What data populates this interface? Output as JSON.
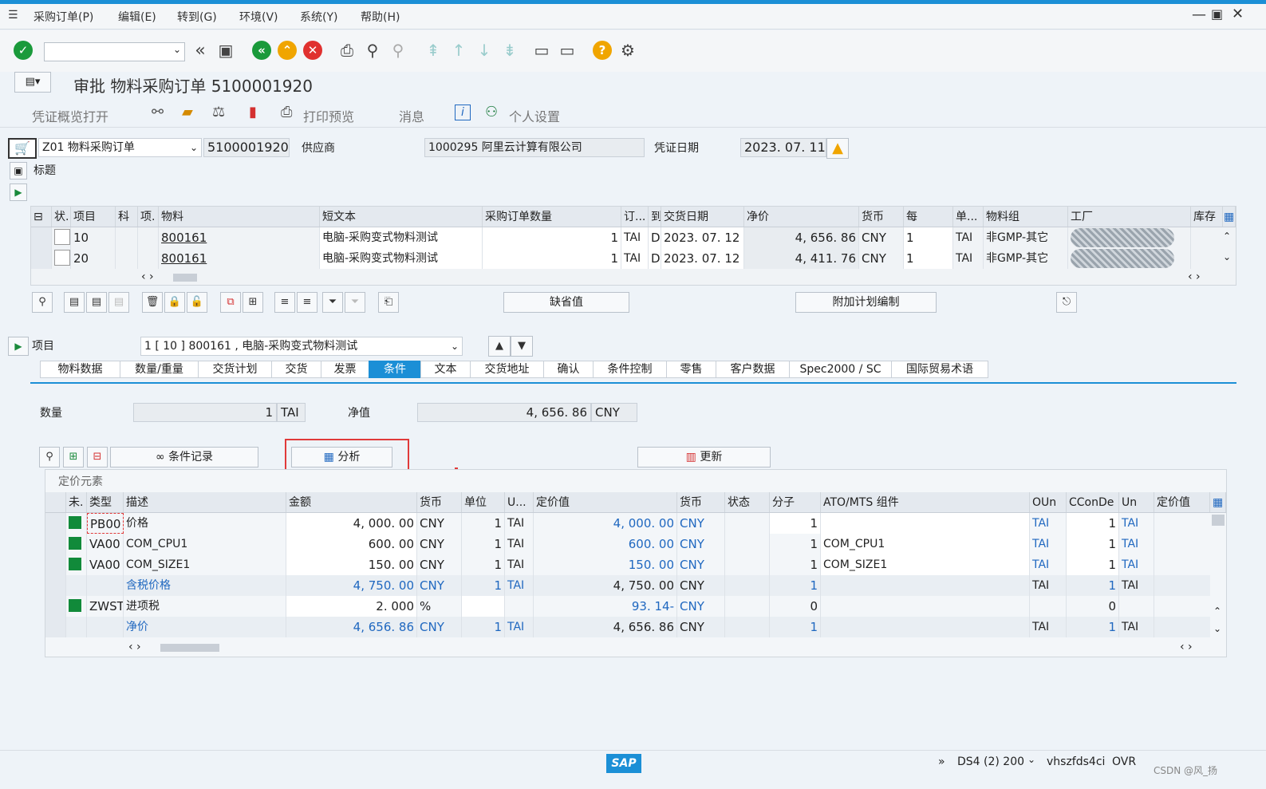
{
  "menu": [
    "采购订单(P)",
    "编辑(E)",
    "转到(G)",
    "环境(V)",
    "系统(Y)",
    "帮助(H)"
  ],
  "title": "审批 物料采购订单 5100001920",
  "app_toolbar": {
    "overview": "凭证概览打开",
    "print_preview": "打印预览",
    "messages": "消息",
    "personal": "个人设置"
  },
  "header": {
    "doc_type": "Z01 物料采购订单",
    "po_number": "5100001920",
    "vendor_label": "供应商",
    "vendor": "1000295 阿里云计算有限公司",
    "doc_date_label": "凭证日期",
    "doc_date": "2023. 07. 11",
    "header_label": "标题"
  },
  "items_table": {
    "columns": [
      "状.",
      "项目",
      "科",
      "项.",
      "物料",
      "短文本",
      "采购订单数量",
      "订...",
      "到",
      "交货日期",
      "净价",
      "货币",
      "每",
      "单...",
      "物料组",
      "工厂",
      "库存"
    ],
    "rows": [
      {
        "item": "10",
        "material": "800161",
        "short_text": "电脑-采购变式物料测试",
        "qty": "1",
        "unit": "TAI",
        "d": "D",
        "date": "2023. 07. 12",
        "net_price": "4, 656. 86",
        "currency": "CNY",
        "per": "1",
        "unit2": "TAI",
        "mat_group": "非GMP-其它"
      },
      {
        "item": "20",
        "material": "800161",
        "short_text": "电脑-采购变式物料测试",
        "qty": "1",
        "unit": "TAI",
        "d": "D",
        "date": "2023. 07. 12",
        "net_price": "4, 411. 76",
        "currency": "CNY",
        "per": "1",
        "unit2": "TAI",
        "mat_group": "非GMP-其它"
      }
    ]
  },
  "buttons": {
    "default_values": "缺省值",
    "additional_planning": "附加计划编制",
    "condition_record": "条件记录",
    "analysis": "分析",
    "update": "更新"
  },
  "item_section": {
    "label": "项目",
    "selected": "1 [ 10 ] 800161 , 电脑-采购变式物料测试"
  },
  "tabs": [
    "物料数据",
    "数量/重量",
    "交货计划",
    "交货",
    "发票",
    "条件",
    "文本",
    "交货地址",
    "确认",
    "条件控制",
    "零售",
    "客户数据",
    "Spec2000 / SC",
    "国际贸易术语"
  ],
  "quantity": {
    "label": "数量",
    "value": "1",
    "unit": "TAI",
    "net_label": "净值",
    "net_value": "4, 656. 86",
    "net_currency": "CNY"
  },
  "pricing": {
    "title": "定价元素",
    "columns": [
      "未.",
      "类型",
      "描述",
      "金额",
      "货币",
      "单位",
      "U...",
      "定价值",
      "货币",
      "状态",
      "分子",
      "ATO/MTS 组件",
      "OUn",
      "CConDe",
      "Un",
      "定价值"
    ],
    "rows": [
      {
        "type": "PB00",
        "desc": "价格",
        "amount": "4, 000. 00",
        "cur": "CNY",
        "per": "1",
        "unit": "TAI",
        "cond_value": "4, 000. 00",
        "cur2": "CNY",
        "num": "1",
        "ato": "",
        "oun": "TAI",
        "ccon": "1",
        "un": "TAI"
      },
      {
        "type": "VA00",
        "desc": "COM_CPU1",
        "amount": "600. 00",
        "cur": "CNY",
        "per": "1",
        "unit": "TAI",
        "cond_value": "600. 00",
        "cur2": "CNY",
        "num": "1",
        "ato": "COM_CPU1",
        "oun": "TAI",
        "ccon": "1",
        "un": "TAI"
      },
      {
        "type": "VA00",
        "desc": "COM_SIZE1",
        "amount": "150. 00",
        "cur": "CNY",
        "per": "1",
        "unit": "TAI",
        "cond_value": "150. 00",
        "cur2": "CNY",
        "num": "1",
        "ato": "COM_SIZE1",
        "oun": "TAI",
        "ccon": "1",
        "un": "TAI"
      },
      {
        "type": "",
        "desc": "含税价格",
        "amount": "4, 750. 00",
        "cur": "CNY",
        "per": "1",
        "unit": "TAI",
        "cond_value": "4, 750. 00",
        "cur2": "CNY",
        "num": "1",
        "ato": "",
        "oun": "TAI",
        "ccon": "1",
        "un": "TAI"
      },
      {
        "type": "ZWST",
        "desc": "进项税",
        "amount": "2. 000",
        "cur": "%",
        "per": "",
        "unit": "",
        "cond_value": "93. 14-",
        "cur2": "CNY",
        "num": "0",
        "ato": "",
        "oun": "",
        "ccon": "0",
        "un": ""
      },
      {
        "type": "",
        "desc": "净价",
        "amount": "4, 656. 86",
        "cur": "CNY",
        "per": "1",
        "unit": "TAI",
        "cond_value": "4, 656. 86",
        "cur2": "CNY",
        "num": "1",
        "ato": "",
        "oun": "TAI",
        "ccon": "1",
        "un": "TAI"
      }
    ]
  },
  "status_bar": {
    "system": "DS4 (2) 200",
    "server": "vhszfds4ci",
    "mode": "OVR",
    "watermark": "CSDN @风_扬",
    "logo": "SAP"
  },
  "colors": {
    "accent": "#1b8fd6",
    "highlight_box": "#e03a3a",
    "status_green": "#118a3a",
    "link_blue": "#2068c0"
  }
}
